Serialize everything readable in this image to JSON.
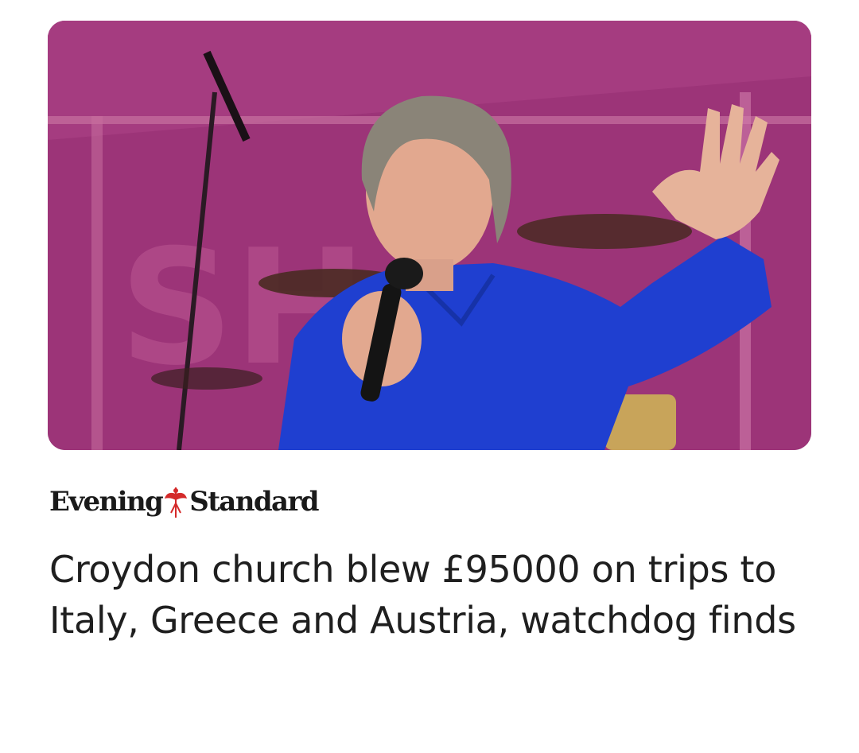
{
  "article": {
    "image_alt": "Man in blue shirt speaking into a microphone on a pink-lit stage",
    "source_name_part1": "Evening",
    "source_name_part2": "Standard",
    "source_logo_icon": "winged-figure-icon",
    "headline": "Croydon church blew £95000 on trips to Italy, Greece and Austria, watchdog finds"
  },
  "colors": {
    "stage_background": "#a2387e",
    "shirt_blue": "#1f3fd0",
    "logo_red": "#d42a2a",
    "text": "#1f1f1f"
  }
}
